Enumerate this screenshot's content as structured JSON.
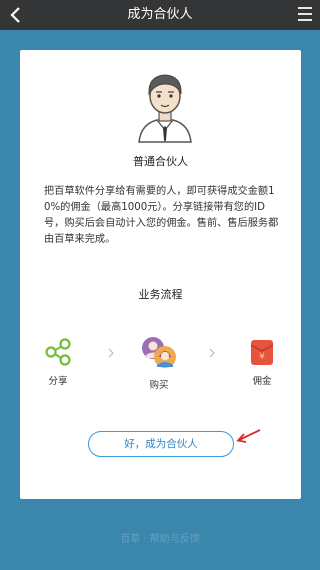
{
  "header": {
    "title": "成为合伙人",
    "back_icon": "chevron-left-icon",
    "menu_icon": "hamburger-menu-icon"
  },
  "card": {
    "avatar_icon": "businessman-avatar-icon",
    "heading": "普通合伙人",
    "description": "把百草软件分享给有需要的人，即可获得成交金额10%的佣金（最高1000元）。分享链接带有您的ID号，购买后会自动计入您的佣金。售前、售后服务都由百草来完成。",
    "process_title": "业务流程",
    "steps": [
      {
        "label": "分享",
        "icon": "share-icon"
      },
      {
        "label": "购买",
        "icon": "users-avatar-icon"
      },
      {
        "label": "佣金",
        "icon": "red-envelope-icon"
      }
    ],
    "join_button": "好，成为合伙人"
  },
  "footer": {
    "text": "百草 · 帮助与反馈"
  },
  "colors": {
    "background": "#3b86ad",
    "topbar": "#333537",
    "accent": "#3b9ad9",
    "share_green": "#6fbf3a",
    "envelope_red": "#e8523f",
    "arrow_red": "#d62d2d"
  }
}
